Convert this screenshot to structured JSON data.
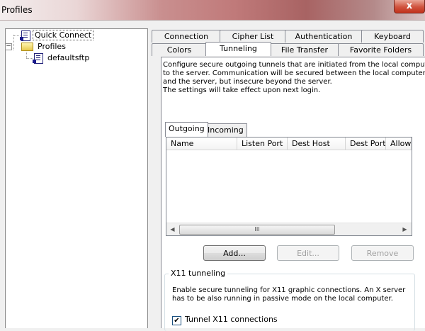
{
  "window": {
    "title": "Profiles",
    "close_glyph": "x"
  },
  "tree": {
    "expander_glyph": "−",
    "items": [
      {
        "label": "Quick Connect",
        "icon": "session-icon"
      },
      {
        "label": "Profiles",
        "icon": "folder-icon"
      },
      {
        "label": "defaultsftp",
        "icon": "session-icon"
      }
    ]
  },
  "tabs": {
    "row_back": [
      "Connection",
      "Cipher List",
      "Authentication",
      "Keyboard"
    ],
    "row_front": [
      "Colors",
      "Tunneling",
      "File Transfer",
      "Favorite Folders"
    ],
    "active": "Tunneling"
  },
  "description": {
    "lines": [
      "Configure secure outgoing tunnels that are initiated from the local computer",
      "to the server. Communication will be secured between the local computer",
      "and the server, but insecure beyond the server.",
      "The settings will take effect upon next login."
    ]
  },
  "inner_tabs": {
    "items": [
      "Outgoing",
      "Incoming"
    ],
    "active": "Outgoing"
  },
  "table": {
    "columns": [
      "Name",
      "Listen Port",
      "Dest Host",
      "Dest Port",
      "Allow"
    ],
    "rows": [],
    "scroll_thumb_glyph": "III",
    "scroll_left_glyph": "◀",
    "scroll_right_glyph": "▶"
  },
  "buttons": {
    "add": "Add...",
    "edit": "Edit...",
    "remove": "Remove"
  },
  "x11": {
    "group_title": "X11 tunneling",
    "lines": [
      "Enable secure tunneling for X11 graphic connections. An X server",
      "has to be also running in passive mode on the local computer."
    ],
    "checkbox_label": "Tunnel X11 connections",
    "checkbox_checked": true,
    "check_glyph": "✔"
  }
}
